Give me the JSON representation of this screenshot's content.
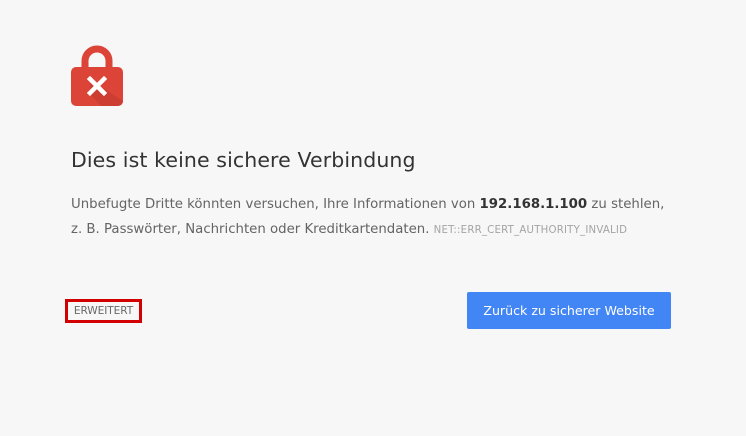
{
  "interstitial": {
    "heading": "Dies ist keine sichere Verbindung",
    "description": {
      "line1_before_host": "Unbefugte Dritte könnten versuchen, Ihre Informationen von ",
      "host": "192.168.1.100",
      "line1_after_host": " zu stehlen,",
      "line2": "z. B. Passwörter, Nachrichten oder Kreditkartendaten.",
      "error_code": "NET::ERR_CERT_AUTHORITY_INVALID"
    },
    "advanced_label": "ERWEITERT",
    "back_button_label": "Zurück zu sicherer Website",
    "icon": "insecure-lock-icon",
    "colors": {
      "lock_red": "#db4437",
      "primary_button": "#4285f4",
      "highlight_border": "#d20000",
      "background": "#f7f7f7"
    }
  }
}
